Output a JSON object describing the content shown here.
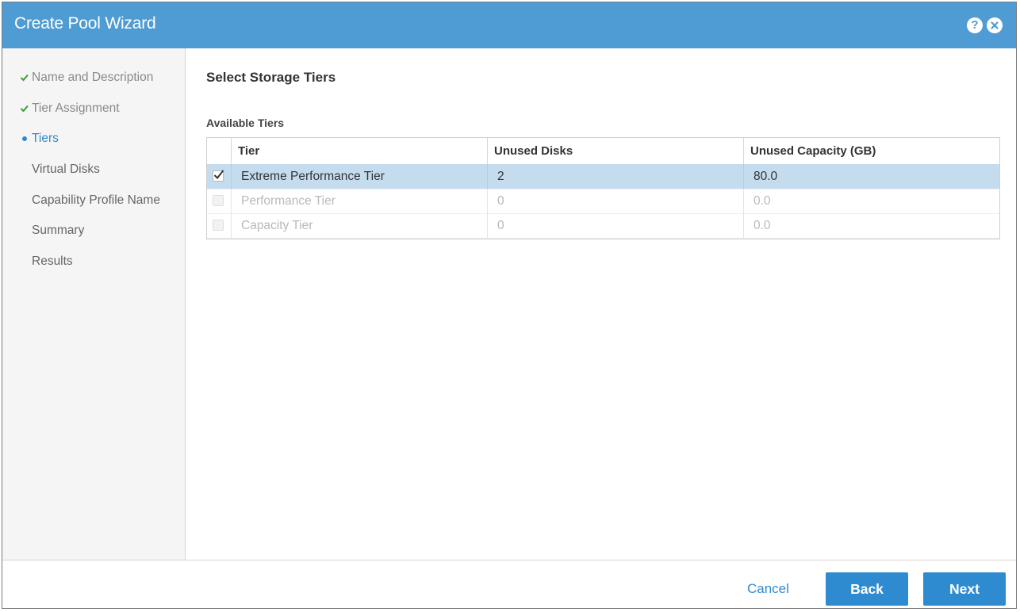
{
  "window": {
    "title": "Create Pool Wizard",
    "help_icon": "?",
    "close_icon": "close-circle-icon"
  },
  "steps": [
    {
      "label": "Name and Description",
      "state": "done"
    },
    {
      "label": "Tier Assignment",
      "state": "done"
    },
    {
      "label": "Tiers",
      "state": "current"
    },
    {
      "label": "Virtual Disks",
      "state": "todo"
    },
    {
      "label": "Capability Profile Name",
      "state": "todo"
    },
    {
      "label": "Summary",
      "state": "todo"
    },
    {
      "label": "Results",
      "state": "todo"
    }
  ],
  "main": {
    "heading": "Select Storage Tiers",
    "table_title": "Available Tiers",
    "columns": [
      "Tier",
      "Unused Disks",
      "Unused Capacity (GB)"
    ],
    "rows": [
      {
        "tier": "Extreme Performance Tier",
        "unused_disks": "2",
        "unused_capacity": "80.0",
        "checked": true,
        "enabled": true
      },
      {
        "tier": "Performance Tier",
        "unused_disks": "0",
        "unused_capacity": "0.0",
        "checked": false,
        "enabled": false
      },
      {
        "tier": "Capacity Tier",
        "unused_disks": "0",
        "unused_capacity": "0.0",
        "checked": false,
        "enabled": false
      }
    ]
  },
  "footer": {
    "cancel_label": "Cancel",
    "back_label": "Back",
    "next_label": "Next"
  },
  "colors": {
    "title_bar": "#4f9bd3",
    "accent": "#2f8bd0",
    "done_check": "#3aa036",
    "selected_row": "#c5dcef"
  }
}
